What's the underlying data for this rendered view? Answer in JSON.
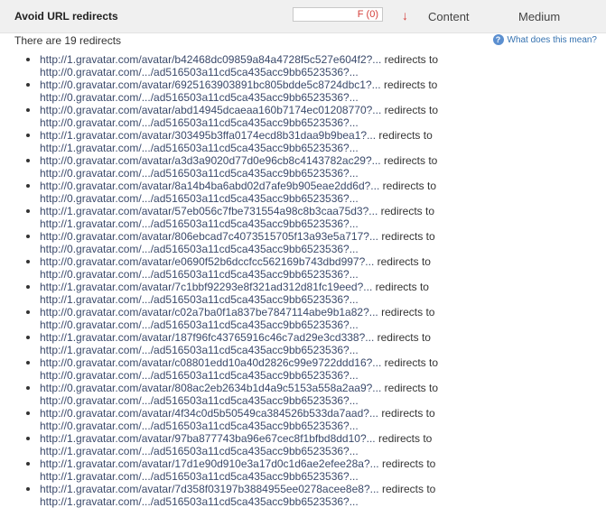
{
  "header": {
    "rule_title": "Avoid URL redirects",
    "grade": "F (0)",
    "type": "Content",
    "priority": "Medium"
  },
  "summary": "There are 19 redirects",
  "help_link": "What does this mean?",
  "redirect_word": "redirects to",
  "redirects": [
    {
      "from": "http://1.gravatar.com/avatar/b42468dc09859a84a4728f5c527e604f2?...",
      "to": "http://0.gravatar.com/.../ad516503a11cd5ca435acc9bb6523536?..."
    },
    {
      "from": "http://0.gravatar.com/avatar/6925163903891bc805bdde5c8724dbc1?...",
      "to": "http://0.gravatar.com/.../ad516503a11cd5ca435acc9bb6523536?..."
    },
    {
      "from": "http://0.gravatar.com/avatar/abd14945dcaeaa160b7174ec01208770?...",
      "to": "http://0.gravatar.com/.../ad516503a11cd5ca435acc9bb6523536?..."
    },
    {
      "from": "http://1.gravatar.com/avatar/303495b3ffa0174ecd8b31daa9b9bea1?...",
      "to": "http://1.gravatar.com/.../ad516503a11cd5ca435acc9bb6523536?..."
    },
    {
      "from": "http://0.gravatar.com/avatar/a3d3a9020d77d0e96cb8c4143782ac29?...",
      "to": "http://0.gravatar.com/.../ad516503a11cd5ca435acc9bb6523536?..."
    },
    {
      "from": "http://0.gravatar.com/avatar/8a14b4ba6abd02d7afe9b905eae2dd6d?...",
      "to": "http://0.gravatar.com/.../ad516503a11cd5ca435acc9bb6523536?..."
    },
    {
      "from": "http://1.gravatar.com/avatar/57eb056c7fbe731554a98c8b3caa75d3?...",
      "to": "http://1.gravatar.com/.../ad516503a11cd5ca435acc9bb6523536?..."
    },
    {
      "from": "http://0.gravatar.com/avatar/806ebcad7c4073515705f13a93e5a717?...",
      "to": "http://0.gravatar.com/.../ad516503a11cd5ca435acc9bb6523536?..."
    },
    {
      "from": "http://0.gravatar.com/avatar/e0690f52b6dccfcc562169b743dbd997?...",
      "to": "http://0.gravatar.com/.../ad516503a11cd5ca435acc9bb6523536?..."
    },
    {
      "from": "http://1.gravatar.com/avatar/7c1bbf92293e8f321ad312d81fc19eed?...",
      "to": "http://1.gravatar.com/.../ad516503a11cd5ca435acc9bb6523536?..."
    },
    {
      "from": "http://0.gravatar.com/avatar/c02a7ba0f1a837be7847114abe9b1a82?...",
      "to": "http://0.gravatar.com/.../ad516503a11cd5ca435acc9bb6523536?..."
    },
    {
      "from": "http://1.gravatar.com/avatar/187f96fc43765916c46c7ad29e3cd338?...",
      "to": "http://1.gravatar.com/.../ad516503a11cd5ca435acc9bb6523536?..."
    },
    {
      "from": "http://0.gravatar.com/avatar/c08801edd10a40d2826c99e9722ddd16?...",
      "to": "http://0.gravatar.com/.../ad516503a11cd5ca435acc9bb6523536?..."
    },
    {
      "from": "http://0.gravatar.com/avatar/808ac2eb2634b1d4a9c5153a558a2aa9?...",
      "to": "http://0.gravatar.com/.../ad516503a11cd5ca435acc9bb6523536?..."
    },
    {
      "from": "http://0.gravatar.com/avatar/4f34c0d5b50549ca384526b533da7aad?...",
      "to": "http://0.gravatar.com/.../ad516503a11cd5ca435acc9bb6523536?..."
    },
    {
      "from": "http://1.gravatar.com/avatar/97ba877743ba96e67cec8f1bfbd8dd10?...",
      "to": "http://1.gravatar.com/.../ad516503a11cd5ca435acc9bb6523536?..."
    },
    {
      "from": "http://1.gravatar.com/avatar/17d1e90d910e3a17d0c1d6ae2efee28a?...",
      "to": "http://1.gravatar.com/.../ad516503a11cd5ca435acc9bb6523536?..."
    },
    {
      "from": "http://1.gravatar.com/avatar/7d358f03197b3884955ee0278acee8e8?...",
      "to": "http://1.gravatar.com/.../ad516503a11cd5ca435acc9bb6523536?..."
    }
  ],
  "colors": {
    "link": "#3b4a6b",
    "help": "#3572b0",
    "grade": "#d43f3a",
    "header_bg": "#f0f0f0"
  }
}
